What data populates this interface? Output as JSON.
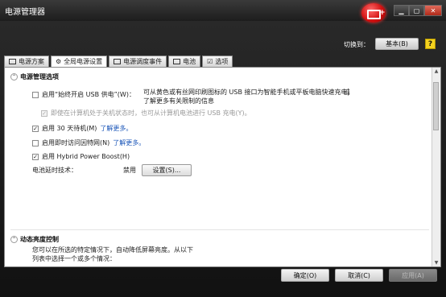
{
  "window": {
    "title": "电源管理器"
  },
  "header": {
    "switch_label": "切换到：",
    "switch_value": "基本(B)",
    "help": "?"
  },
  "tabs": [
    {
      "label": "电源方案"
    },
    {
      "label": "全局电源设置"
    },
    {
      "label": "电源调度事件"
    },
    {
      "label": "电池"
    },
    {
      "label": "选项"
    }
  ],
  "section1": {
    "title": "电源管理选项",
    "usb_always_on": {
      "label": "启用“始终开启 USB 供电”(W)：",
      "checked": false
    },
    "usb_desc": "可从黄色或有丝网印刷图标的 USB 接口为智能手机或平板电脑快速充电。",
    "usb_link": "了解更多有关限制的信息",
    "usb_sub": {
      "label": "即使在计算机处于关机状态时，也可从计算机电池进行 USB 充电(Y)。",
      "checked": true
    },
    "standby30": {
      "label": "启用 30 天待机(M)",
      "link": "了解更多。",
      "checked": true
    },
    "instant_internet": {
      "label": "启用即时访问因特网(N)",
      "link": "了解更多。",
      "checked": false
    },
    "hybrid_boost": {
      "label": "启用 Hybrid Power Boost(H)",
      "checked": true
    },
    "battery_ext": {
      "label": "电池延时技术：",
      "value": "禁用",
      "button": "设置(S)..."
    }
  },
  "section2": {
    "title": "动态亮度控制",
    "desc_line1": "您可以在所选的特定情况下，自动降低屏幕亮度。从以下",
    "desc_line2": "列表中选择一个或多个情况："
  },
  "footer": {
    "ok": "确定(O)",
    "cancel": "取消(C)",
    "apply": "应用(A)"
  }
}
